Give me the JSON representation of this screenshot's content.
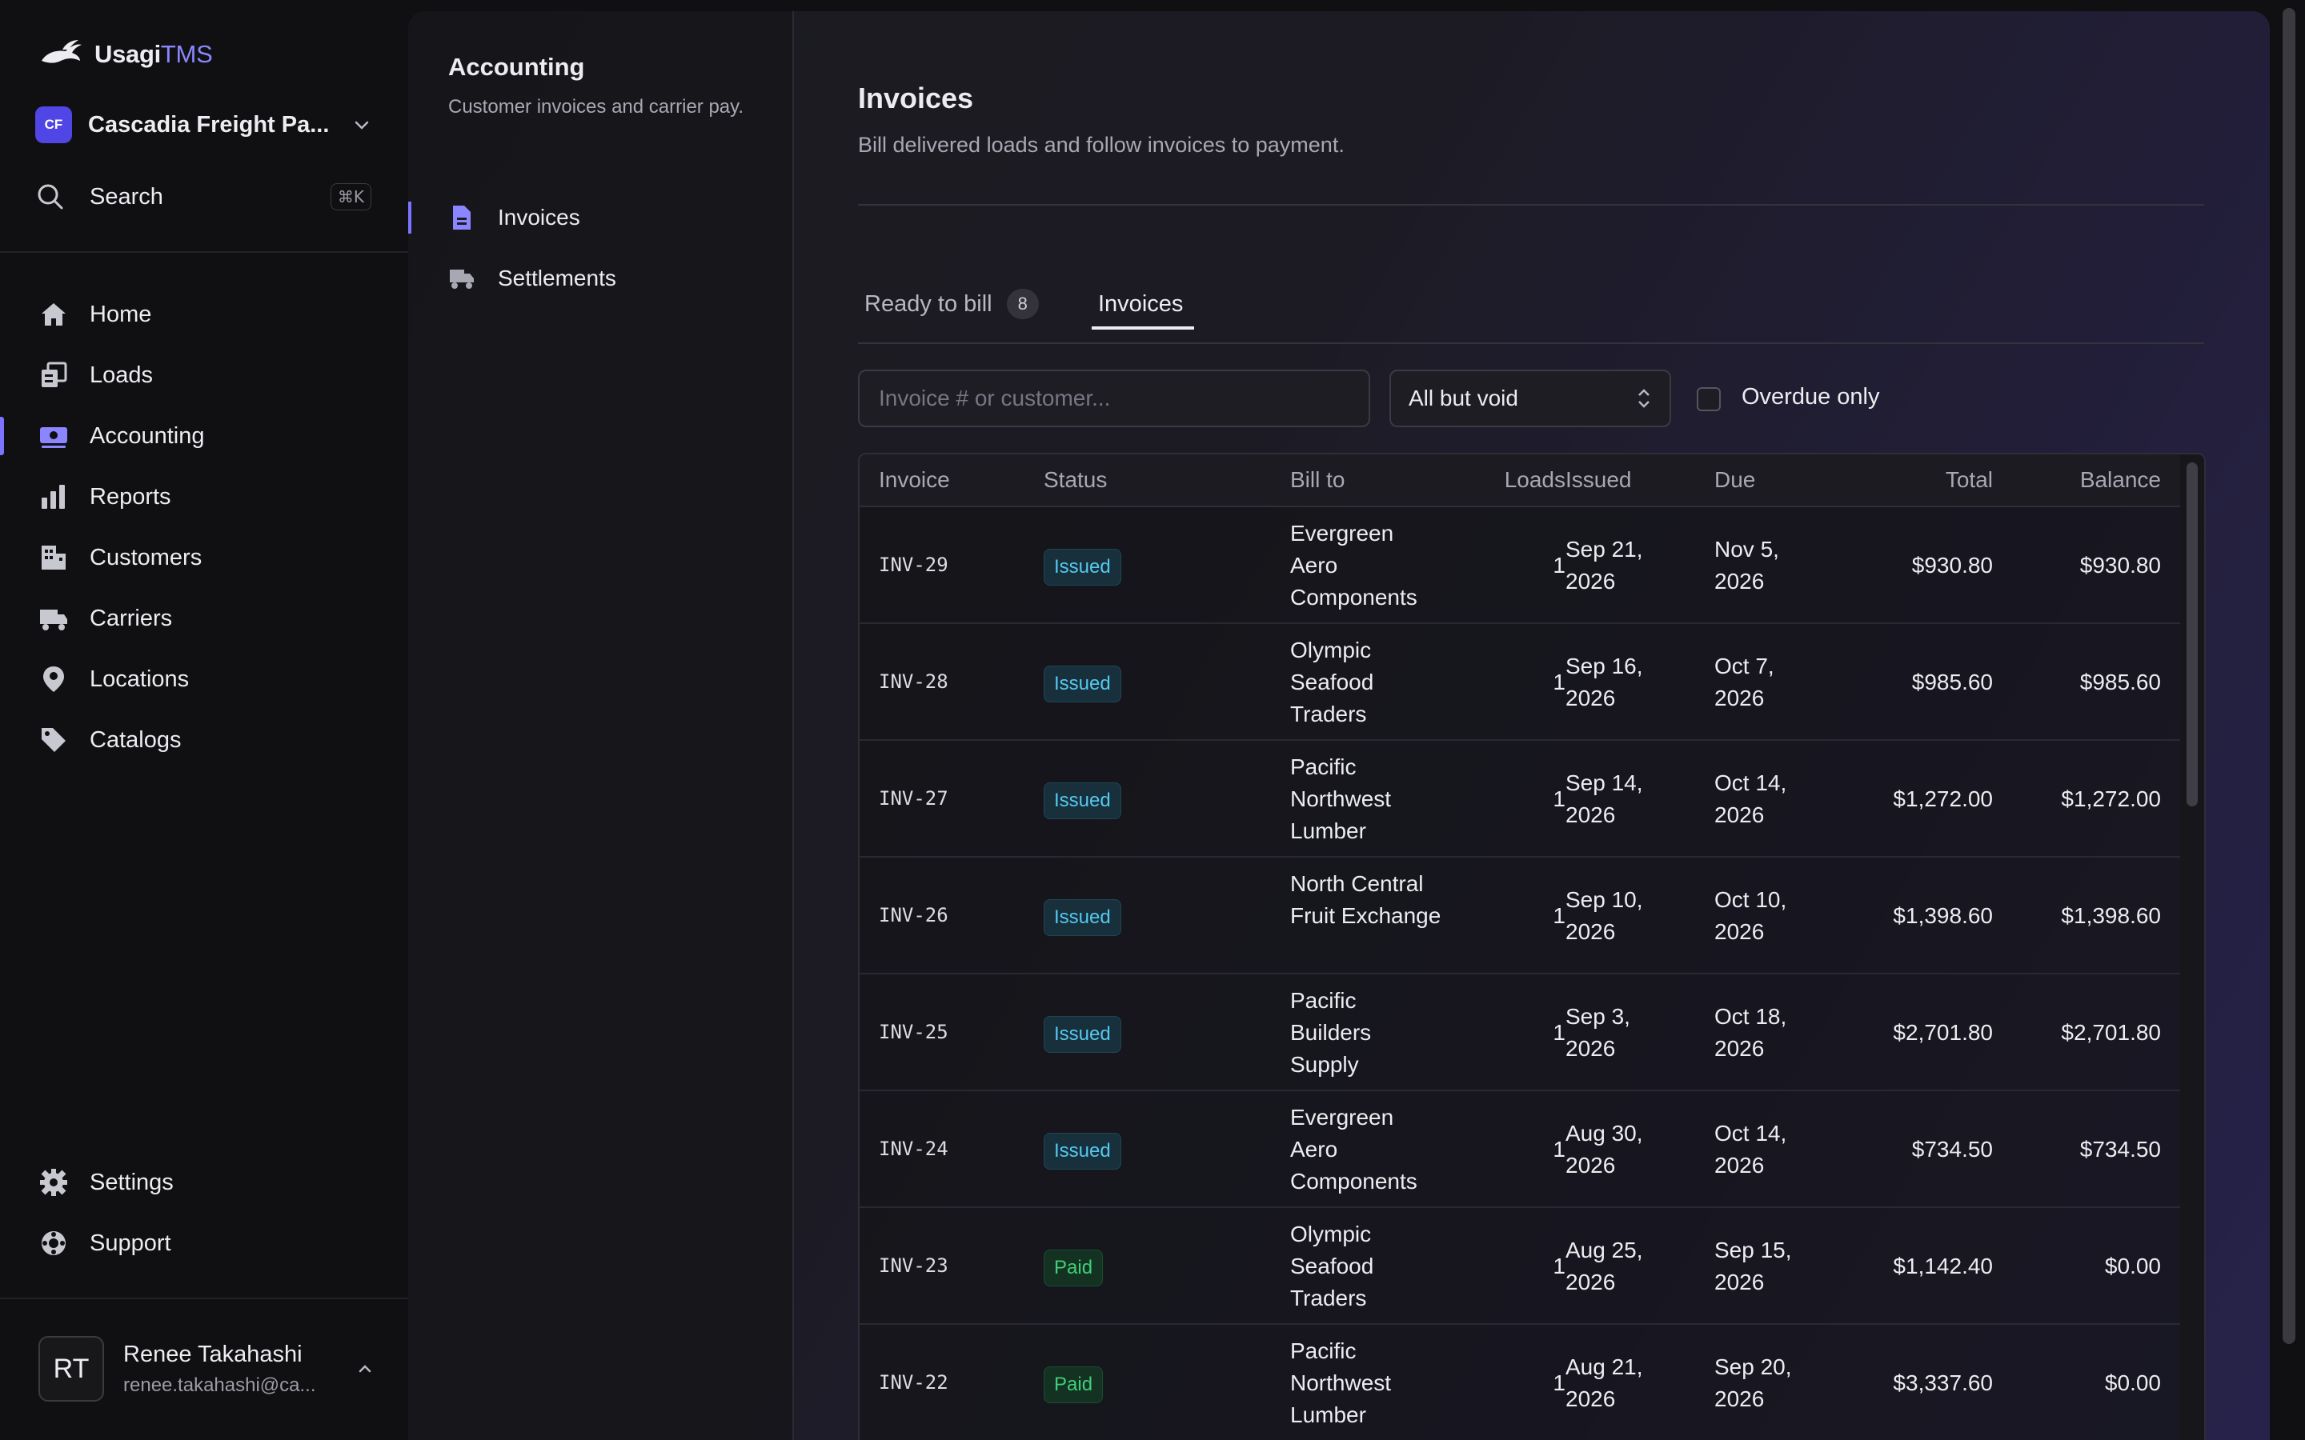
{
  "brand": {
    "name": "Usagi",
    "suffix": "TMS"
  },
  "org": {
    "initials": "CF",
    "name": "Cascadia Freight Pa..."
  },
  "search": {
    "label": "Search",
    "shortcut": "⌘K"
  },
  "nav": {
    "items": [
      {
        "label": "Home",
        "icon": "home-icon"
      },
      {
        "label": "Loads",
        "icon": "loads-icon"
      },
      {
        "label": "Accounting",
        "icon": "accounting-icon",
        "active": true
      },
      {
        "label": "Reports",
        "icon": "reports-icon"
      },
      {
        "label": "Customers",
        "icon": "customers-icon"
      },
      {
        "label": "Carriers",
        "icon": "carriers-icon"
      },
      {
        "label": "Locations",
        "icon": "locations-icon"
      },
      {
        "label": "Catalogs",
        "icon": "catalogs-icon"
      }
    ],
    "bottom": [
      {
        "label": "Settings",
        "icon": "gear-icon"
      },
      {
        "label": "Support",
        "icon": "support-icon"
      }
    ]
  },
  "user": {
    "initials": "RT",
    "name": "Renee Takahashi",
    "email": "renee.takahashi@ca..."
  },
  "section": {
    "title": "Accounting",
    "description": "Customer invoices and carrier pay.",
    "items": [
      {
        "label": "Invoices",
        "active": true
      },
      {
        "label": "Settlements"
      }
    ]
  },
  "page": {
    "title": "Invoices",
    "description": "Bill delivered loads and follow invoices to payment."
  },
  "tabs": [
    {
      "label": "Ready to bill",
      "count": "8"
    },
    {
      "label": "Invoices",
      "active": true
    }
  ],
  "filters": {
    "search_placeholder": "Invoice # or customer...",
    "status_value": "All but void",
    "overdue_label": "Overdue only"
  },
  "table": {
    "headers": [
      "Invoice",
      "Status",
      "Bill to",
      "Loads",
      "Issued",
      "Due",
      "Total",
      "Balance"
    ],
    "rows": [
      {
        "invoice": "INV-29",
        "status": "Issued",
        "bill_to": "Evergreen Aero Components",
        "loads": "1",
        "issued": "Sep 21, 2026",
        "due": "Nov 5, 2026",
        "total": "$930.80",
        "balance": "$930.80"
      },
      {
        "invoice": "INV-28",
        "status": "Issued",
        "bill_to": "Olympic Seafood Traders",
        "loads": "1",
        "issued": "Sep 16, 2026",
        "due": "Oct 7, 2026",
        "total": "$985.60",
        "balance": "$985.60"
      },
      {
        "invoice": "INV-27",
        "status": "Issued",
        "bill_to": "Pacific Northwest Lumber",
        "loads": "1",
        "issued": "Sep 14, 2026",
        "due": "Oct 14, 2026",
        "total": "$1,272.00",
        "balance": "$1,272.00"
      },
      {
        "invoice": "INV-26",
        "status": "Issued",
        "bill_to": "North Central Fruit Exchange",
        "loads": "1",
        "issued": "Sep 10, 2026",
        "due": "Oct 10, 2026",
        "total": "$1,398.60",
        "balance": "$1,398.60"
      },
      {
        "invoice": "INV-25",
        "status": "Issued",
        "bill_to": "Pacific Builders Supply",
        "loads": "1",
        "issued": "Sep 3, 2026",
        "due": "Oct 18, 2026",
        "total": "$2,701.80",
        "balance": "$2,701.80"
      },
      {
        "invoice": "INV-24",
        "status": "Issued",
        "bill_to": "Evergreen Aero Components",
        "loads": "1",
        "issued": "Aug 30, 2026",
        "due": "Oct 14, 2026",
        "total": "$734.50",
        "balance": "$734.50"
      },
      {
        "invoice": "INV-23",
        "status": "Paid",
        "bill_to": "Olympic Seafood Traders",
        "loads": "1",
        "issued": "Aug 25, 2026",
        "due": "Sep 15, 2026",
        "total": "$1,142.40",
        "balance": "$0.00"
      },
      {
        "invoice": "INV-22",
        "status": "Paid",
        "bill_to": "Pacific Northwest Lumber",
        "loads": "1",
        "issued": "Aug 21, 2026",
        "due": "Sep 20, 2026",
        "total": "$3,337.60",
        "balance": "$0.00"
      }
    ]
  },
  "colors": {
    "accent": "#7c74ff",
    "issued": "#56c8ef",
    "paid": "#3fcf7a",
    "background": "#101012"
  }
}
